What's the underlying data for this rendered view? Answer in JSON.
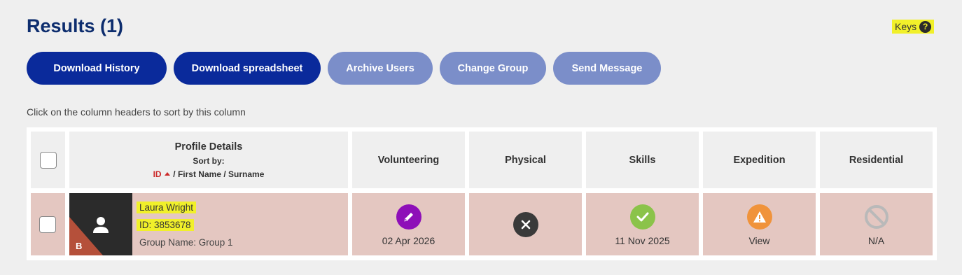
{
  "header": {
    "title": "Results (1)",
    "keys_label": "Keys",
    "help_glyph": "?"
  },
  "buttons": {
    "download_history": "Download History",
    "download_spreadsheet": "Download spreadsheet",
    "archive_users": "Archive Users",
    "change_group": "Change Group",
    "send_message": "Send Message"
  },
  "hint": "Click on the column headers to sort by this column",
  "table": {
    "profile_header": "Profile Details",
    "sort_by": "Sort by:",
    "sort_options": [
      "ID",
      "First Name",
      "Surname"
    ],
    "sort_separator": "/",
    "columns": [
      "Volunteering",
      "Physical",
      "Skills",
      "Expedition",
      "Residential"
    ]
  },
  "row": {
    "name": "Laura Wright",
    "id_text": "ID: 3853678",
    "group": "Group Name: Group 1",
    "level_badge": "B",
    "statuses": [
      {
        "icon": "pencil-icon",
        "color": "#8e0fb8",
        "text": "02 Apr 2026"
      },
      {
        "icon": "cross-icon",
        "color": "#3a3a3a",
        "text": ""
      },
      {
        "icon": "check-icon",
        "color": "#8bc34a",
        "text": "11 Nov 2025"
      },
      {
        "icon": "warning-icon",
        "color": "#f0933b",
        "text": "View"
      },
      {
        "icon": "not-allowed-icon",
        "color": "#b9b9b9",
        "text": "N/A"
      }
    ]
  },
  "colors": {
    "primary_button": "#0a2a9b",
    "disabled_button": "#7b8ec9",
    "row_bg": "#e4c7c1",
    "highlight": "#f1f02a",
    "title": "#0d2d6e",
    "badge": "#b5503a"
  }
}
